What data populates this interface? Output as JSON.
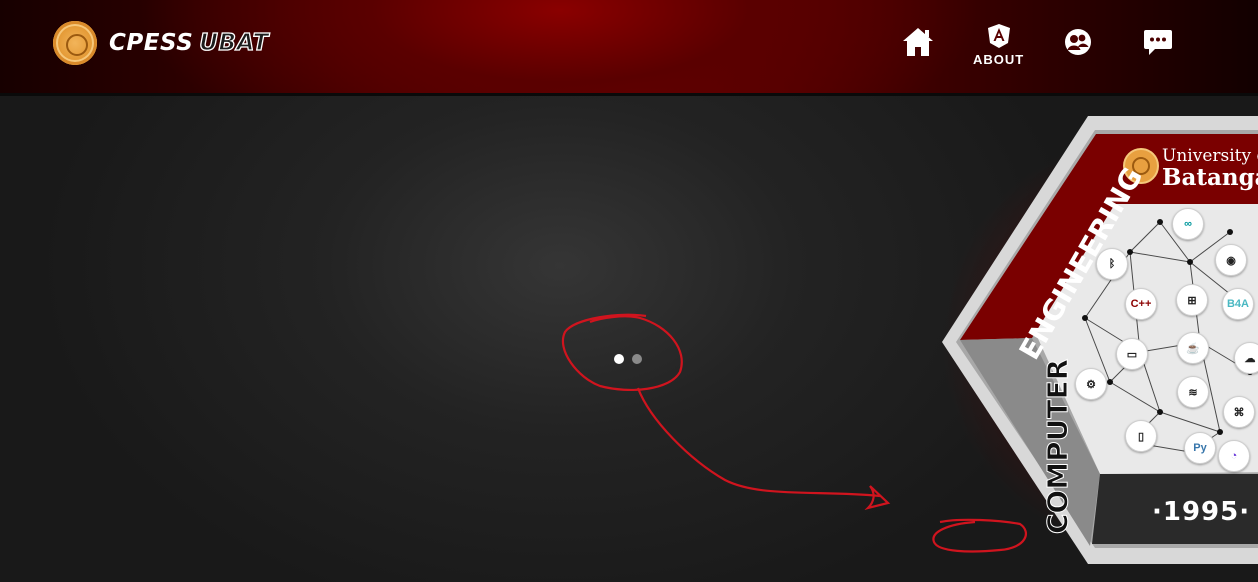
{
  "header": {
    "brand_primary": "CPESS",
    "brand_secondary": "UBAT",
    "nav": [
      {
        "name": "home",
        "label": ""
      },
      {
        "name": "about",
        "label": "ABOUT"
      },
      {
        "name": "officers",
        "label": ""
      },
      {
        "name": "messages",
        "label": ""
      }
    ]
  },
  "carousel": {
    "active_index": 0,
    "count": 2,
    "active_color": "#ffffff",
    "inactive_color": "#8a8a8a"
  },
  "logo": {
    "university_line1": "University of",
    "university_line2": "Batangas",
    "banner_top": "ENGINEERING",
    "banner_side": "COMPUTER",
    "year": "·1995·",
    "tech_icons": [
      "arduino",
      "bluetooth",
      "android",
      "c++",
      "network",
      "B4A",
      "monitor",
      "java",
      "cloud-download",
      "gear",
      "wifi",
      "app-grid",
      "phone",
      "python",
      "bot"
    ]
  },
  "colors": {
    "accent_red": "#8b0000",
    "annotation_red": "#d0141e",
    "background": "#1e1e1e"
  }
}
